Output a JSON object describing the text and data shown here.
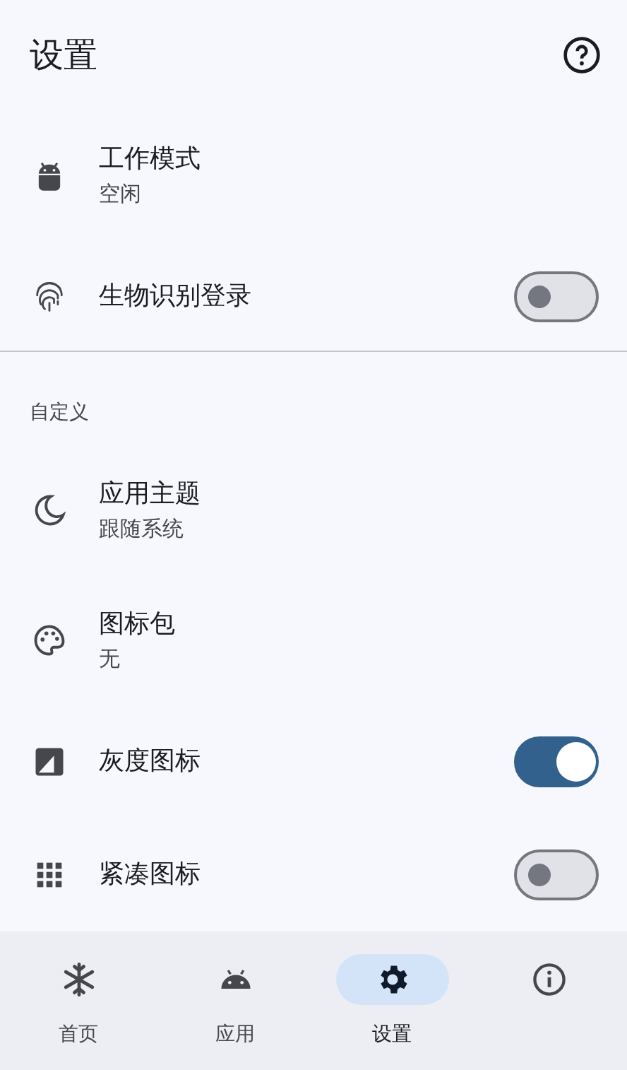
{
  "header": {
    "title": "设置"
  },
  "sections": [
    {
      "items": [
        {
          "kind": "subtitle",
          "label": "工作模式",
          "subtitle": "空闲"
        },
        {
          "kind": "switch",
          "label": "生物识别登录",
          "on": false
        }
      ]
    },
    {
      "title": "自定义",
      "items": [
        {
          "kind": "subtitle",
          "label": "应用主题",
          "subtitle": "跟随系统"
        },
        {
          "kind": "subtitle",
          "label": "图标包",
          "subtitle": "无"
        },
        {
          "kind": "switch",
          "label": "灰度图标",
          "on": true
        },
        {
          "kind": "switch",
          "label": "紧凑图标",
          "on": false
        }
      ]
    }
  ],
  "nav": [
    {
      "label": "首页",
      "selected": false
    },
    {
      "label": "应用",
      "selected": false
    },
    {
      "label": "设置",
      "selected": true
    },
    {
      "selected": false
    }
  ]
}
